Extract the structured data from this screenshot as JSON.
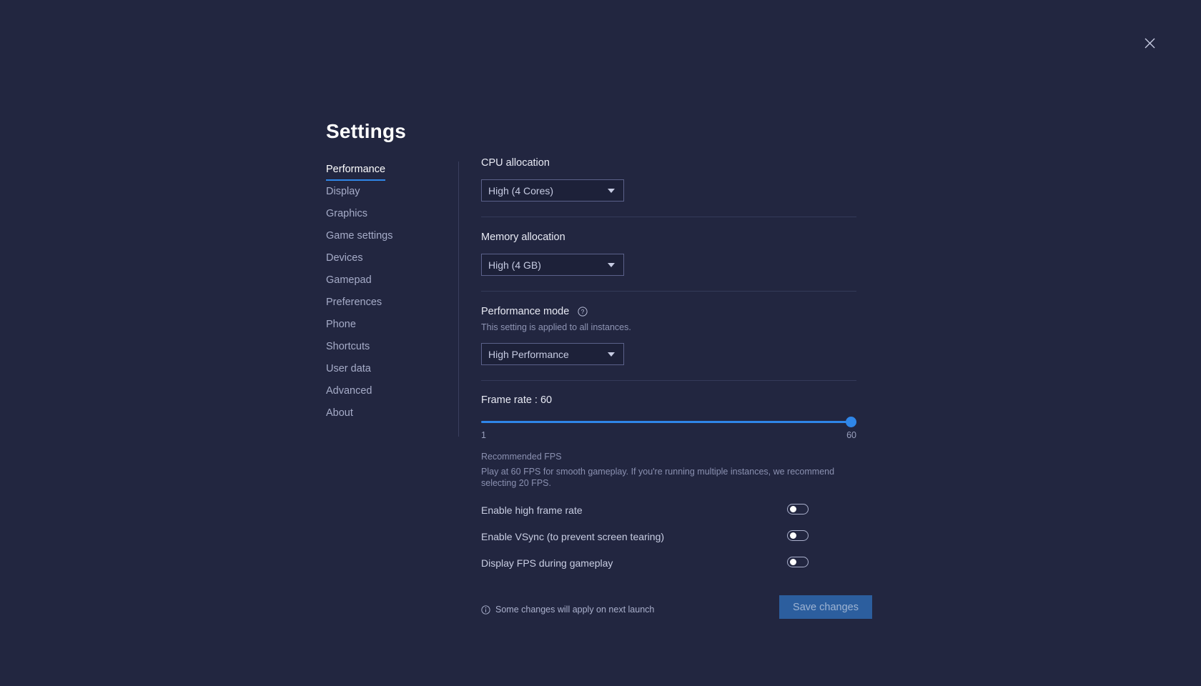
{
  "window": {
    "title": "Settings",
    "close_icon": "close-icon"
  },
  "sidebar": {
    "items": [
      {
        "label": "Performance",
        "active": true
      },
      {
        "label": "Display",
        "active": false
      },
      {
        "label": "Graphics",
        "active": false
      },
      {
        "label": "Game settings",
        "active": false
      },
      {
        "label": "Devices",
        "active": false
      },
      {
        "label": "Gamepad",
        "active": false
      },
      {
        "label": "Preferences",
        "active": false
      },
      {
        "label": "Phone",
        "active": false
      },
      {
        "label": "Shortcuts",
        "active": false
      },
      {
        "label": "User data",
        "active": false
      },
      {
        "label": "Advanced",
        "active": false
      },
      {
        "label": "About",
        "active": false
      }
    ]
  },
  "performance": {
    "cpu": {
      "label": "CPU allocation",
      "value": "High (4 Cores)"
    },
    "memory": {
      "label": "Memory allocation",
      "value": "High (4 GB)"
    },
    "mode": {
      "label": "Performance mode",
      "help_icon": "help-circle-icon",
      "description": "This setting is applied to all instances.",
      "value": "High Performance"
    },
    "frame_rate": {
      "label": "Frame rate : 60",
      "value": 60,
      "min": "1",
      "max": "60",
      "fill_percent": 100,
      "recommended_title": "Recommended FPS",
      "recommended_body": "Play at 60 FPS for smooth gameplay. If you're running multiple instances, we recommend selecting 20 FPS."
    },
    "toggles": [
      {
        "label": "Enable high frame rate",
        "on": false
      },
      {
        "label": "Enable VSync (to prevent screen tearing)",
        "on": false
      },
      {
        "label": "Display FPS during gameplay",
        "on": false
      }
    ]
  },
  "footer": {
    "info_icon": "info-circle-icon",
    "note": "Some changes will apply on next launch",
    "save_label": "Save changes"
  },
  "colors": {
    "background": "#222640",
    "accent": "#2f86e8",
    "save_button": "#2c5e9e",
    "divider": "#343a59"
  }
}
